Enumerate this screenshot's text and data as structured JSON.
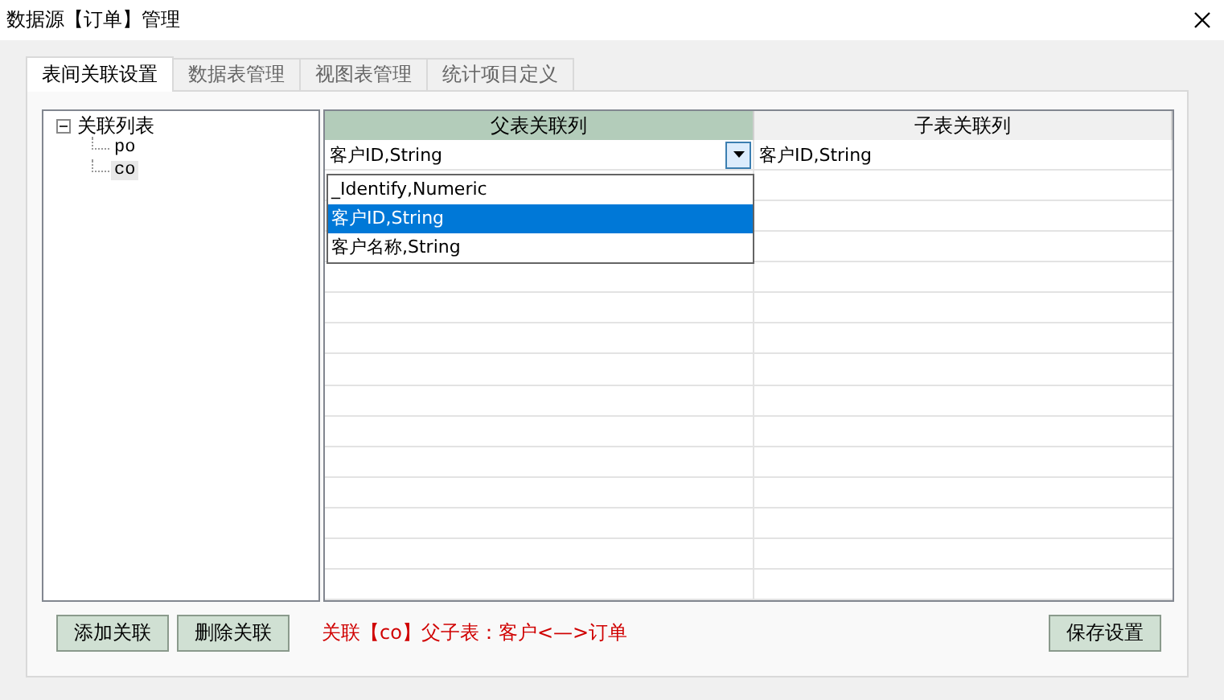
{
  "window": {
    "title": "数据源【订单】管理"
  },
  "tabs": [
    {
      "label": "表间关联设置",
      "selected": true
    },
    {
      "label": "数据表管理",
      "selected": false
    },
    {
      "label": "视图表管理",
      "selected": false
    },
    {
      "label": "统计项目定义",
      "selected": false
    }
  ],
  "tree": {
    "label": "关联列表",
    "expanded": true,
    "children": [
      {
        "label": "po",
        "selected": false
      },
      {
        "label": "co",
        "selected": true
      }
    ]
  },
  "grid": {
    "columns": [
      "父表关联列",
      "子表关联列"
    ],
    "rows": [
      {
        "parent": "客户ID,String",
        "child": "客户ID,String"
      }
    ],
    "dropdown": {
      "options": [
        {
          "label": "_Identify,Numeric",
          "selected": false
        },
        {
          "label": "客户ID,String",
          "selected": true
        },
        {
          "label": "客户名称,String",
          "selected": false
        }
      ]
    }
  },
  "buttons_left": [
    "添加关联",
    "删除关联"
  ],
  "status": "关联【co】父子表：客户<—>订单",
  "save_button": "保存设置"
}
